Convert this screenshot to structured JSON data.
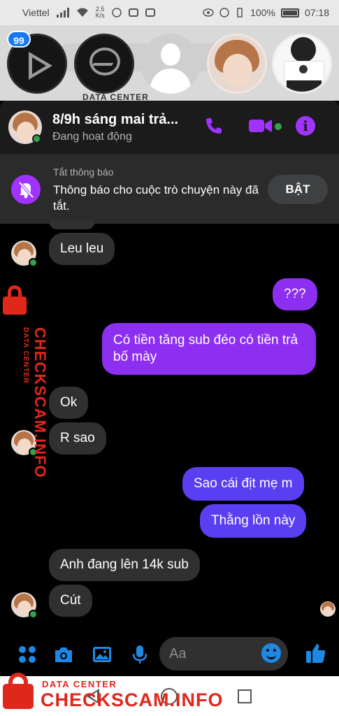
{
  "status_bar": {
    "carrier": "Viettel",
    "speed_value": "2.5",
    "speed_unit": "K/s",
    "battery": "100%",
    "time": "07:18"
  },
  "chat_heads": {
    "badge_count": "99",
    "items": [
      "video-player",
      "messenger",
      "contact-placeholder",
      "contact-boy",
      "contact-girl"
    ]
  },
  "background_watermark": "DATA CENTER",
  "header": {
    "name": "8/9h sáng mai trả...",
    "status": "Đang hoạt động",
    "accent": "#a033ff",
    "online_color": "#31a24c"
  },
  "mute_banner": {
    "title": "Tắt thông báo",
    "text": "Thông báo cho cuộc trò chuyện này đã tắt.",
    "button": "BẬT"
  },
  "messages": [
    {
      "side": "received",
      "text": "Leu leu"
    },
    {
      "side": "sent",
      "text": "???"
    },
    {
      "side": "sent",
      "text": "Có tiền tăng sub đéo có tiền trả bố mày"
    },
    {
      "side": "received",
      "text": "Ok"
    },
    {
      "side": "received",
      "text": "R sao"
    },
    {
      "side": "sent",
      "text": "Sao cái địt mẹ m"
    },
    {
      "side": "sent",
      "text": "Thằng lồn này"
    },
    {
      "side": "received",
      "text": "Anh đang lên 14k sub"
    },
    {
      "side": "received",
      "text": "Cút"
    }
  ],
  "composer": {
    "placeholder": "Aa",
    "icons": [
      "menu-dots-icon",
      "camera-icon",
      "gallery-icon",
      "microphone-icon",
      "emoji-icon",
      "thumbs-up-icon"
    ]
  },
  "watermark": {
    "small": "DATA CENTER",
    "big": "CHECKSCAM.INFO",
    "color": "#e0271c"
  }
}
